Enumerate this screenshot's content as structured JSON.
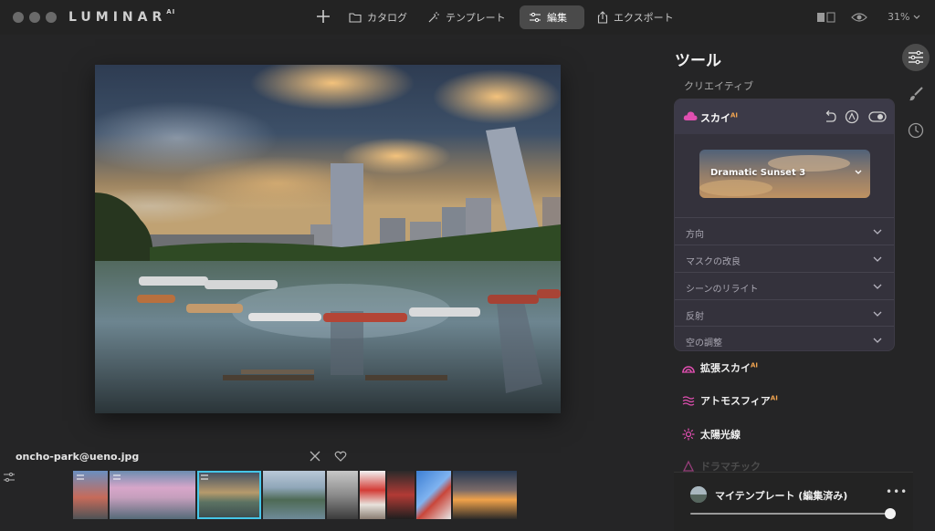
{
  "app": {
    "brand": "LUMINAR",
    "brand_sup": "AI"
  },
  "nav": {
    "catalog": "カタログ",
    "templates": "テンプレート",
    "edit": "編集",
    "export": "エクスポート",
    "zoom": "31%"
  },
  "filmstrip": {
    "filename": "oncho-park@ueno.jpg",
    "selected_index": 2
  },
  "tools": {
    "title": "ツール",
    "section": "クリエイティブ",
    "sky": {
      "label": "スカイ",
      "ai": "AI",
      "preset": "Dramatic Sunset 3",
      "options": [
        "方向",
        "マスクの改良",
        "シーンのリライト",
        "反射",
        "空の調整"
      ]
    },
    "items": [
      {
        "label": "拡張スカイ",
        "ai": "AI",
        "icon": "augmented-sky-icon"
      },
      {
        "label": "アトモスフィア",
        "ai": "AI",
        "icon": "atmosphere-icon"
      },
      {
        "label": "太陽光線",
        "ai": "",
        "icon": "sunrays-icon"
      },
      {
        "label": "ドラマチック",
        "ai": "",
        "icon": "dramatic-icon"
      }
    ]
  },
  "template_bar": {
    "name": "マイテンプレート (編集済み)",
    "more": "•••",
    "amount": 1.0
  },
  "colors": {
    "accent": "#45c6e8",
    "sky_pink": "#e04fb0",
    "ai_orange": "#f3a550"
  }
}
